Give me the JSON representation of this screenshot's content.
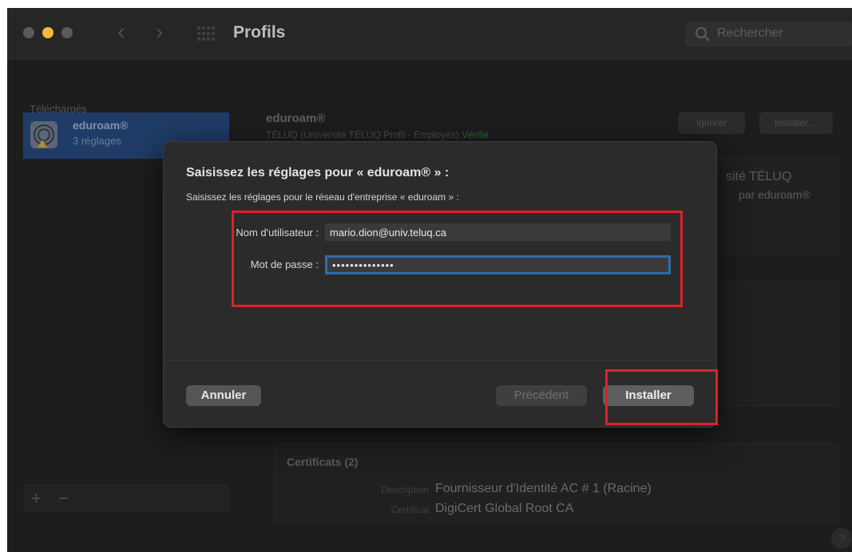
{
  "window": {
    "title": "Profils"
  },
  "search": {
    "placeholder": "Rechercher"
  },
  "sidebar": {
    "section": "Téléchargés",
    "items": [
      {
        "name": "eduroam®",
        "subtitle": "3 réglages"
      }
    ],
    "add_label": "+",
    "remove_label": "−"
  },
  "detail": {
    "name": "eduroam®",
    "subtitle": "TÉLUQ (Université TÉLUQ Profil - Employés)",
    "verified": "Vérifié",
    "ignore_label": "Ignorer",
    "install_label": "Installer…",
    "box_line1": "sité TÉLUQ",
    "box_line2": "par eduroam®",
    "certificates": {
      "title": "Certificats (2)",
      "rows": [
        {
          "label": "Description",
          "value": "Fournisseur d'Identité AC # 1 (Racine)"
        },
        {
          "label": "Certificat",
          "value": "DigiCert Global Root CA"
        }
      ]
    },
    "help": "?"
  },
  "dialog": {
    "title": "Saisissez les réglages pour « eduroam® » :",
    "subtitle": "Saisissez les réglages pour le réseau d'entreprise « eduroam » :",
    "username_label": "Nom d'utilisateur :",
    "username_value": "mario.dion@univ.teluq.ca",
    "password_label": "Mot de passe :",
    "password_value": "••••••••••••••",
    "cancel_label": "Annuler",
    "previous_label": "Précédent",
    "install_label": "Installer"
  },
  "colors": {
    "highlight": "#e0202a",
    "focus_ring": "#2e6cae",
    "sidebar_selection": "#1f3c68",
    "traffic_light_minimize": "#f3b93c"
  }
}
